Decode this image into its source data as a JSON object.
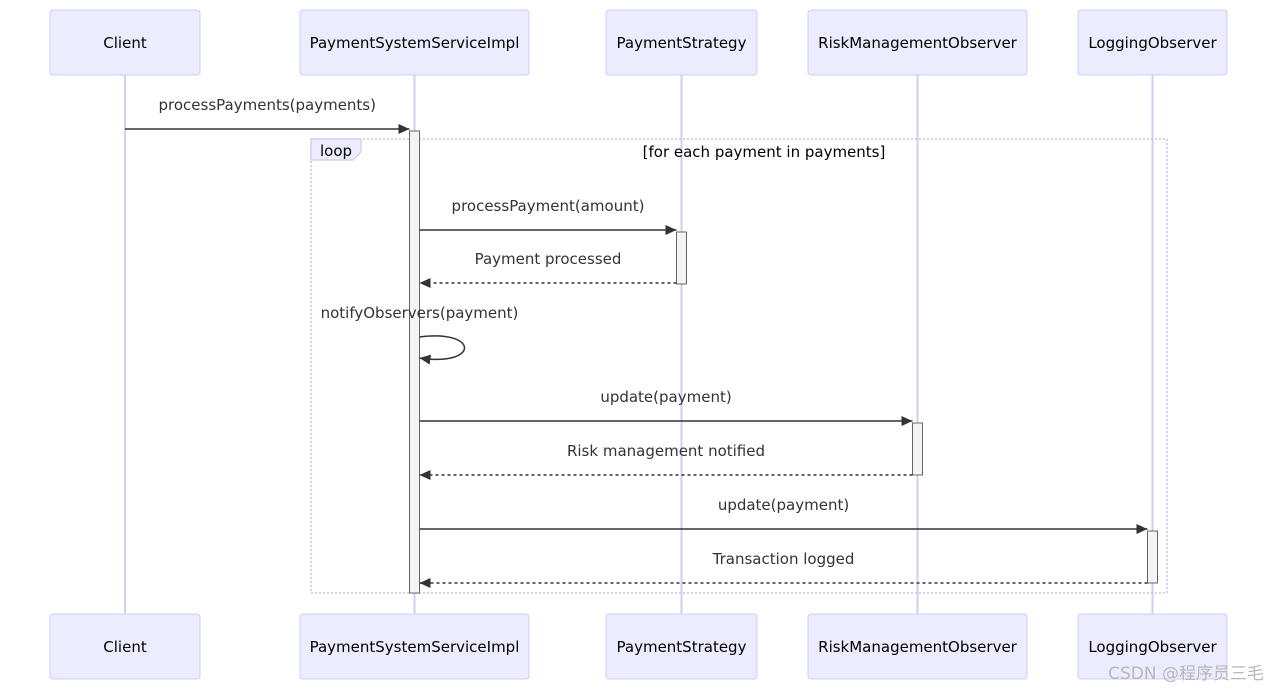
{
  "diagram": {
    "type": "sequence",
    "participants": [
      "Client",
      "PaymentSystemServiceImpl",
      "PaymentStrategy",
      "RiskManagementObserver",
      "LoggingObserver"
    ],
    "loop": {
      "label": "loop",
      "condition": "[for each payment in payments]"
    },
    "messages": [
      {
        "from": 0,
        "to": 1,
        "label": "processPayments(payments)",
        "style": "solid"
      },
      {
        "from": 1,
        "to": 2,
        "label": "processPayment(amount)",
        "style": "solid"
      },
      {
        "from": 2,
        "to": 1,
        "label": "Payment processed",
        "style": "dashed"
      },
      {
        "from": 1,
        "to": 1,
        "label": "notifyObservers(payment)",
        "style": "solid"
      },
      {
        "from": 1,
        "to": 3,
        "label": "update(payment)",
        "style": "solid"
      },
      {
        "from": 3,
        "to": 1,
        "label": "Risk management notified",
        "style": "dashed"
      },
      {
        "from": 1,
        "to": 4,
        "label": "update(payment)",
        "style": "solid"
      },
      {
        "from": 4,
        "to": 1,
        "label": "Transaction logged",
        "style": "dashed"
      }
    ],
    "colors": {
      "actor_fill": "#ECECFF",
      "actor_border": "#CCCCFF",
      "lifeline": "#D4CCF5",
      "arrow": "#333333",
      "activation_fill": "#F4F4F4",
      "activation_border": "#666666",
      "loop_border": "#C8C0F0"
    }
  },
  "watermark": "CSDN @程序员三毛"
}
